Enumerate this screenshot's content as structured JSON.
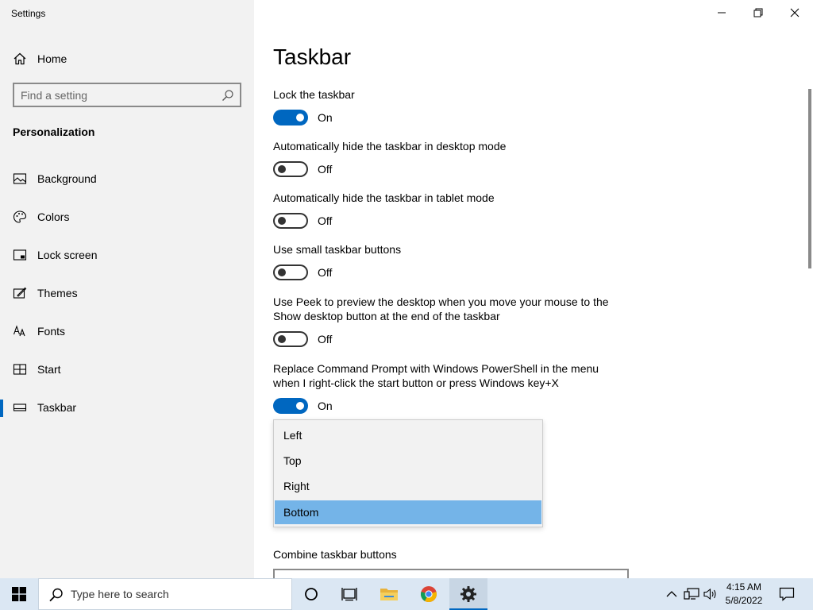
{
  "app": {
    "title": "Settings"
  },
  "sidebar": {
    "home_label": "Home",
    "search_placeholder": "Find a setting",
    "section": "Personalization",
    "items": [
      {
        "label": "Background",
        "icon": "image-icon"
      },
      {
        "label": "Colors",
        "icon": "palette-icon"
      },
      {
        "label": "Lock screen",
        "icon": "lock-screen-icon"
      },
      {
        "label": "Themes",
        "icon": "themes-icon"
      },
      {
        "label": "Fonts",
        "icon": "fonts-icon"
      },
      {
        "label": "Start",
        "icon": "start-icon"
      },
      {
        "label": "Taskbar",
        "icon": "taskbar-icon",
        "active": true
      }
    ]
  },
  "main": {
    "title": "Taskbar",
    "settings": [
      {
        "label": "Lock the taskbar",
        "state": "On"
      },
      {
        "label": "Automatically hide the taskbar in desktop mode",
        "state": "Off"
      },
      {
        "label": "Automatically hide the taskbar in tablet mode",
        "state": "Off"
      },
      {
        "label": "Use small taskbar buttons",
        "state": "Off"
      },
      {
        "label": "Use Peek to preview the desktop when you move your mouse to the Show desktop button at the end of the taskbar",
        "state": "Off"
      },
      {
        "label": "Replace Command Prompt with Windows PowerShell in the menu when I right-click the start button or press Windows key+X",
        "state": "On"
      }
    ],
    "location_options": [
      "Left",
      "Top",
      "Right",
      "Bottom"
    ],
    "location_selected": "Bottom",
    "combine_label": "Combine taskbar buttons"
  },
  "taskbar": {
    "search_text": "Type here to search",
    "time": "4:15 AM",
    "date": "5/8/2022"
  },
  "colors": {
    "accent": "#0067c0",
    "selected": "#74b4e8",
    "sidebar_bg": "#f2f2f2",
    "taskbar_bg": "#dbe7f3"
  }
}
